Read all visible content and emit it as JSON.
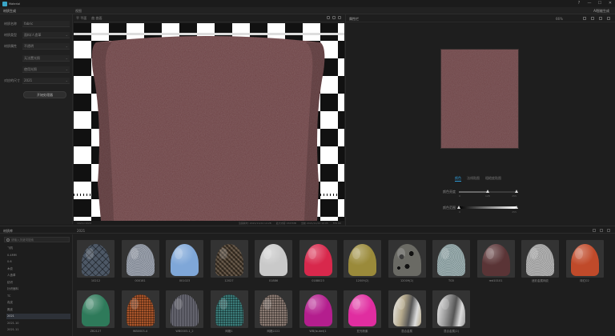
{
  "app": {
    "name": "Material"
  },
  "window_controls": [
    "?",
    "—",
    "☐",
    "✕"
  ],
  "toolbar": {
    "left_label": "材质生成",
    "view_label": "视图",
    "right_button": "AI智能生成"
  },
  "left_panel": {
    "fields": [
      {
        "label": "材质名称",
        "value": "fabric"
      },
      {
        "label": "材质类型",
        "value": "面料/人造革"
      },
      {
        "label": "材质属性",
        "value": "不透明"
      },
      {
        "label": "",
        "value": "无法置光照"
      },
      {
        "label": "",
        "value": "使用光照"
      },
      {
        "label": "对应的尺寸",
        "value": "2021"
      }
    ],
    "generate_button": "开始处理器"
  },
  "viewport": {
    "toolbar": [
      "平 平面",
      "曲 曲面",
      "球 球面"
    ],
    "status_left": "1024×1024",
    "status_right": [
      "渲染耗时: 2021/11/24 14:28",
      "最大内存 1567MB",
      "当前 2021/11/24 10:05",
      "FPS 60"
    ]
  },
  "right_panel": {
    "title": "属性栏",
    "zoom": "66%",
    "swatch_color": "#6e4446",
    "tabs": [
      "颜色",
      "法线贴图",
      "粗糙度贴图"
    ],
    "active_tab": 0,
    "sliders": [
      {
        "label": "颜色亮度",
        "min": "0",
        "mid": "128",
        "max": "255",
        "value": 0.5
      },
      {
        "label": "颜色范围",
        "min": "0",
        "max": "255",
        "value": 1.0
      }
    ]
  },
  "library": {
    "title": "材质库",
    "path": "2021",
    "search_placeholder": "请输入关键词搜索",
    "tree": [
      "飞机",
      "0.4MM",
      "0.6",
      "木纹",
      "人造革",
      "纺织",
      "针织面料",
      "TC",
      "真皮",
      "麂皮",
      "2021",
      "2021.10",
      "2021.11"
    ],
    "selected_index": 10,
    "items": [
      {
        "name": "10212",
        "color": "#4d5866",
        "pattern": "quilt"
      },
      {
        "name": "000181",
        "color": "#8f96a3",
        "pattern": "noise"
      },
      {
        "name": "001023",
        "color": "#7fa7d8",
        "pattern": "plain"
      },
      {
        "name": "12027",
        "color": "#5a4a38",
        "pattern": "check"
      },
      {
        "name": "01886",
        "color": "#c9c9c9",
        "pattern": "plain"
      },
      {
        "name": "0188023",
        "color": "#d8284c",
        "pattern": "plain"
      },
      {
        "name": "12009(2)",
        "color": "#9a8a3a",
        "pattern": "plain"
      },
      {
        "name": "12009(2)",
        "color": "#6a6a64",
        "pattern": "leopard"
      },
      {
        "name": "TG5",
        "color": "#8fa4a6",
        "pattern": "noise"
      },
      {
        "name": "red10101",
        "color": "#5a3436",
        "pattern": "plain"
      },
      {
        "name": "迷彩金属网纹",
        "color": "#a9a9a9",
        "pattern": "noise"
      },
      {
        "name": "砖红02",
        "color": "#c04a2a",
        "pattern": "plain"
      },
      {
        "name": "ZB2127",
        "color": "#2e7a5a",
        "pattern": "plain"
      },
      {
        "name": "WB0003-4",
        "color": "#a8542a",
        "pattern": "mesh"
      },
      {
        "name": "WB0003-1_2",
        "color": "#5a5a66",
        "pattern": "knit"
      },
      {
        "name": "网格1",
        "color": "#3a7a78",
        "pattern": "mesh"
      },
      {
        "name": "网格2222",
        "color": "#8a7a72",
        "pattern": "mesh"
      },
      {
        "name": "WB(lsuket)1",
        "color": "#b41e8e",
        "pattern": "plain"
      },
      {
        "name": "亚光粉紫",
        "color": "#e02da0",
        "pattern": "plain"
      },
      {
        "name": "混合金属",
        "color": "#b6aa8c",
        "pattern": "metal"
      },
      {
        "name": "混合金属(2)",
        "color": "#9a9a9a",
        "pattern": "metal"
      }
    ]
  }
}
